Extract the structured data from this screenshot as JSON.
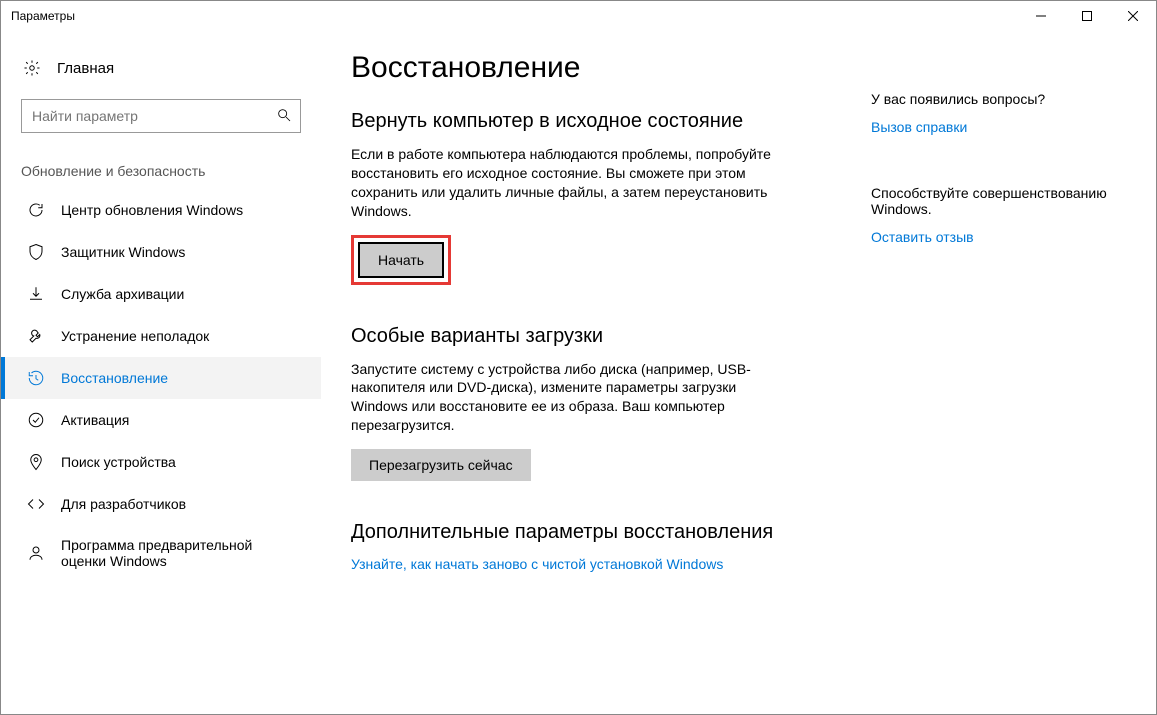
{
  "window": {
    "title": "Параметры"
  },
  "sidebar": {
    "home": "Главная",
    "search_placeholder": "Найти параметр",
    "section_label": "Обновление и безопасность",
    "items": [
      {
        "label": "Центр обновления Windows"
      },
      {
        "label": "Защитник Windows"
      },
      {
        "label": "Служба архивации"
      },
      {
        "label": "Устранение неполадок"
      },
      {
        "label": "Восстановление"
      },
      {
        "label": "Активация"
      },
      {
        "label": "Поиск устройства"
      },
      {
        "label": "Для разработчиков"
      },
      {
        "label": "Программа предварительной оценки Windows"
      }
    ]
  },
  "main": {
    "page_title": "Восстановление",
    "reset": {
      "heading": "Вернуть компьютер в исходное состояние",
      "desc": "Если в работе компьютера наблюдаются проблемы, попробуйте восстановить его исходное состояние. Вы сможете при этом сохранить или удалить личные файлы, а затем переустановить Windows.",
      "button": "Начать"
    },
    "advanced": {
      "heading": "Особые варианты загрузки",
      "desc": "Запустите систему с устройства либо диска (например, USB-накопителя или DVD-диска), измените параметры загрузки Windows или восстановите ее из образа. Ваш компьютер перезагрузится.",
      "button": "Перезагрузить сейчас"
    },
    "more": {
      "heading": "Дополнительные параметры восстановления",
      "link": "Узнайте, как начать заново с чистой установкой Windows"
    }
  },
  "aside": {
    "questions_head": "У вас появились вопросы?",
    "help_link": "Вызов справки",
    "improve_head": "Способствуйте совершенствованию Windows.",
    "feedback_link": "Оставить отзыв"
  }
}
